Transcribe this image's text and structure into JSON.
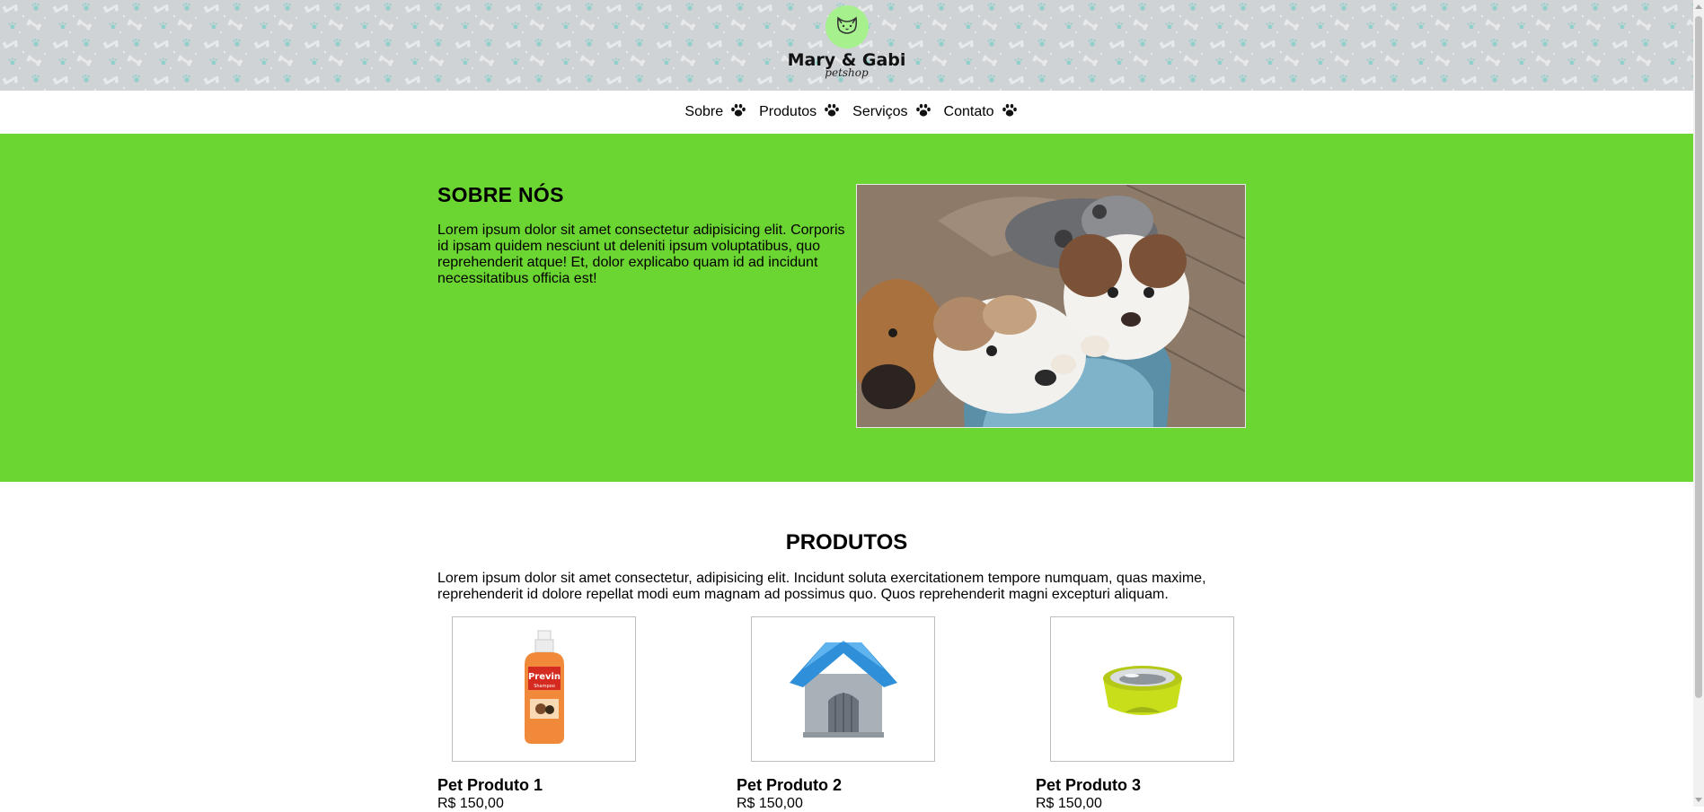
{
  "header": {
    "brand_name": "Mary & Gabi",
    "brand_sub": "petshop",
    "logo_icon": "cat-face-icon",
    "pattern": "bones-and-paws"
  },
  "nav": {
    "items": [
      {
        "label": "Sobre",
        "icon": "paw-icon"
      },
      {
        "label": "Produtos",
        "icon": "paw-icon"
      },
      {
        "label": "Serviços",
        "icon": "paw-icon"
      },
      {
        "label": "Contato",
        "icon": "paw-icon"
      }
    ]
  },
  "about": {
    "title": "SOBRE NÓS",
    "text": "Lorem ipsum dolor sit amet consectetur adipisicing elit. Corporis id ipsam quidem nesciunt ut deleniti ipsum voluptatibus, quo reprehenderit atque! Et, dolor explicabo quam id ad incidunt necessitatibus officia est!",
    "image": "puppies-in-basket-photo"
  },
  "products": {
    "title": "PRODUTOS",
    "text": "Lorem ipsum dolor sit amet consectetur, adipisicing elit. Incidunt soluta exercitationem tempore numquam, quas maxime, reprehenderit id dolore repellat modi eum magnam ad possimus quo. Quos reprehenderit magni excepturi aliquam.",
    "items": [
      {
        "name": "Pet Produto 1",
        "price": "R$ 150,00",
        "image": "shampoo-bottle-image"
      },
      {
        "name": "Pet Produto 2",
        "price": "R$ 150,00",
        "image": "dog-house-image"
      },
      {
        "name": "Pet Produto 3",
        "price": "R$ 150,00",
        "image": "pet-bowl-image"
      }
    ]
  },
  "colors": {
    "about_bg": "#6bd532",
    "header_bg": "#cfd3d6",
    "logo_badge": "#a6f08d",
    "pattern_accent": "#7fc4bd"
  }
}
